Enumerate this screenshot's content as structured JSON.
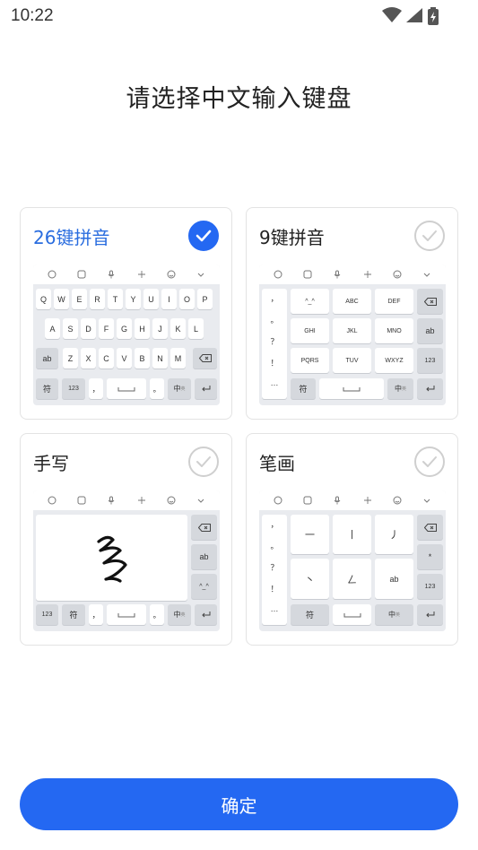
{
  "status_bar": {
    "time": "10:22"
  },
  "title": "请选择中文输入键盘",
  "cards": [
    {
      "label": "26键拼音",
      "selected": true
    },
    {
      "label": "9键拼音",
      "selected": false
    },
    {
      "label": "手写",
      "selected": false
    },
    {
      "label": "笔画",
      "selected": false
    }
  ],
  "qwerty": {
    "row1": [
      "Q",
      "W",
      "E",
      "R",
      "T",
      "Y",
      "U",
      "I",
      "O",
      "P"
    ],
    "row2": [
      "A",
      "S",
      "D",
      "F",
      "G",
      "H",
      "J",
      "K",
      "L"
    ],
    "row3": [
      "Z",
      "X",
      "C",
      "V",
      "B",
      "N",
      "M"
    ],
    "ab": "ab",
    "sym": "符",
    "num": "123",
    "comma": "，",
    "period": "。",
    "lang": "中",
    "lang_sub": "英"
  },
  "nine_key": {
    "punct": [
      "，",
      "。",
      "？",
      "！",
      "…"
    ],
    "keys": [
      "^_^",
      "ABC",
      "DEF",
      "GHI",
      "JKL",
      "MNO",
      "PQRS",
      "TUV",
      "WXYZ"
    ],
    "ab": "ab",
    "num": "123",
    "sym": "符",
    "lang": "中",
    "lang_sub": "英"
  },
  "handwrite": {
    "ab": "ab",
    "emoticon": "^_^",
    "num": "123",
    "sym": "符",
    "comma": "，",
    "period": "。",
    "lang": "中",
    "lang_sub": "英"
  },
  "stroke": {
    "punct": [
      "，",
      "。",
      "？",
      "！",
      "…"
    ],
    "keys": [
      "一",
      "丨",
      "丿",
      "丶",
      "ㄥ",
      "ab"
    ],
    "star": "*",
    "num": "123",
    "sym": "符",
    "lang": "中",
    "lang_sub": "英"
  },
  "confirm_label": "确定",
  "colors": {
    "accent": "#2468f2",
    "selected_text": "#2a6ddf"
  }
}
